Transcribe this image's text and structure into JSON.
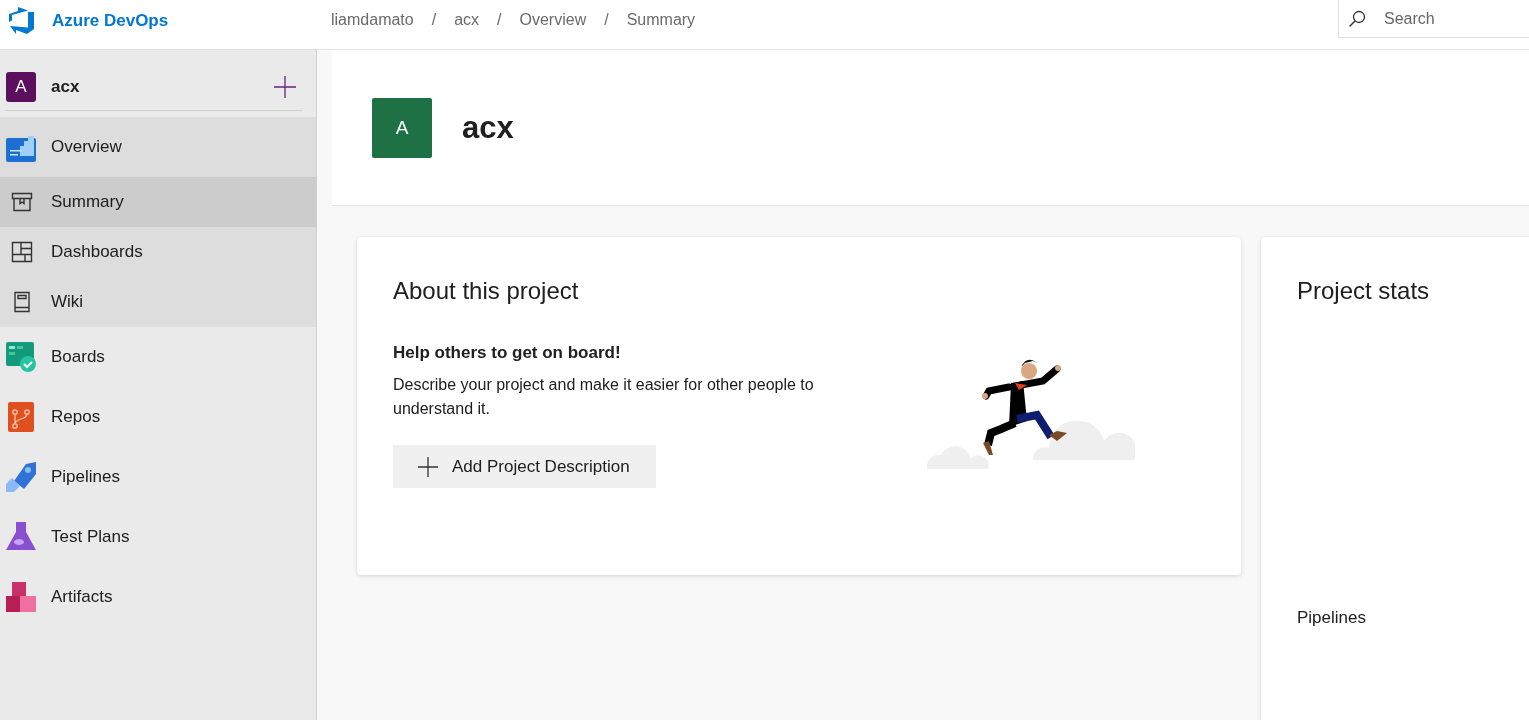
{
  "top_bar": {
    "product": "Azure DevOps",
    "breadcrumbs": [
      {
        "label": "liamdamato"
      },
      {
        "separator": "/",
        "label": "acx"
      },
      {
        "separator": "/",
        "label": "Overview"
      },
      {
        "separator": "/",
        "label": "Summary"
      }
    ],
    "search": {
      "placeholder": "Search"
    }
  },
  "sidebar": {
    "project": {
      "avatar": "A",
      "name": "acx"
    },
    "items": [
      {
        "label": "Overview",
        "selected": false,
        "expanded": true,
        "children": [
          {
            "label": "Summary",
            "selected": true
          },
          {
            "label": "Dashboards",
            "selected": false
          },
          {
            "label": "Wiki",
            "selected": false
          }
        ]
      },
      {
        "label": "Boards",
        "selected": false
      },
      {
        "label": "Repos",
        "selected": false
      },
      {
        "label": "Pipelines",
        "selected": false
      },
      {
        "label": "Test Plans",
        "selected": false
      },
      {
        "label": "Artifacts",
        "selected": false
      }
    ]
  },
  "project_header": {
    "avatar": "A",
    "title": "acx"
  },
  "about_card": {
    "title": "About this project",
    "heading": "Help others to get on board!",
    "description": "Describe your project and make it easier for other people to understand it.",
    "button": "Add Project Description"
  },
  "stats_card": {
    "title": "Project stats",
    "section": "Pipelines"
  }
}
